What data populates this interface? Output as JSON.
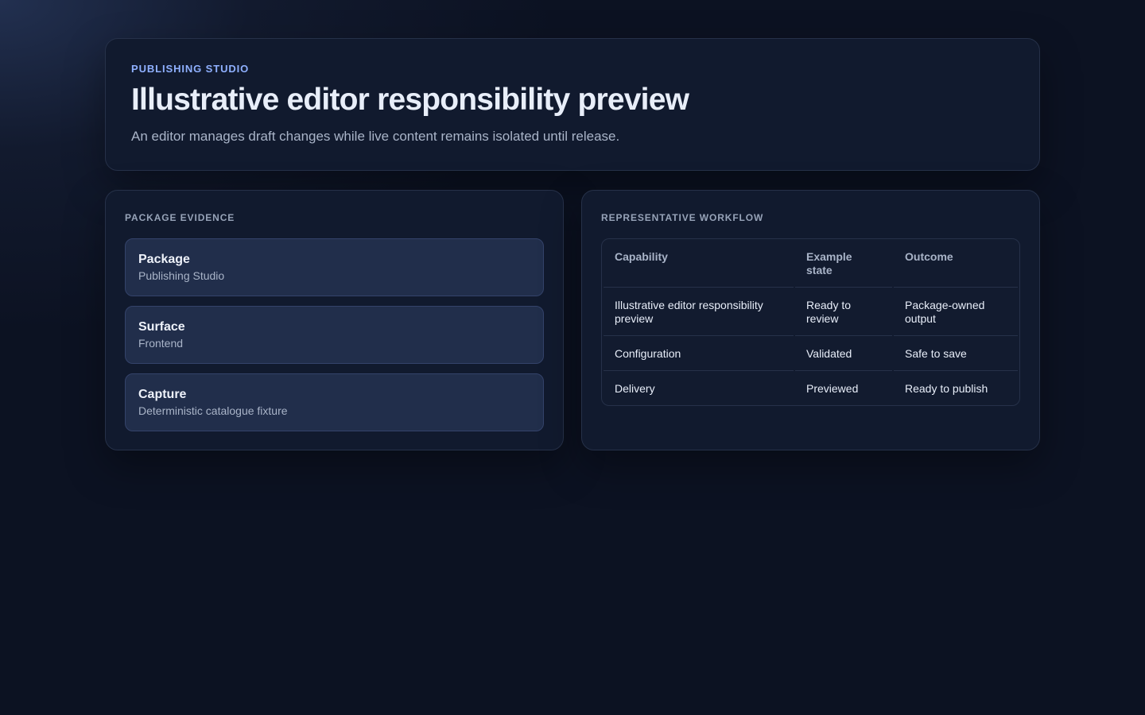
{
  "hero": {
    "eyebrow": "PUBLISHING STUDIO",
    "title": "Illustrative editor responsibility preview",
    "subtitle": "An editor manages draft changes while live content remains isolated until release."
  },
  "evidence": {
    "heading": "PACKAGE EVIDENCE",
    "items": [
      {
        "label": "Package",
        "value": "Publishing Studio"
      },
      {
        "label": "Surface",
        "value": "Frontend"
      },
      {
        "label": "Capture",
        "value": "Deterministic catalogue fixture"
      }
    ]
  },
  "workflow": {
    "heading": "REPRESENTATIVE WORKFLOW",
    "columns": [
      "Capability",
      "Example state",
      "Outcome"
    ],
    "rows": [
      [
        "Illustrative editor responsibility preview",
        "Ready to review",
        "Package-owned output"
      ],
      [
        "Configuration",
        "Validated",
        "Safe to save"
      ],
      [
        "Delivery",
        "Previewed",
        "Ready to publish"
      ]
    ]
  }
}
